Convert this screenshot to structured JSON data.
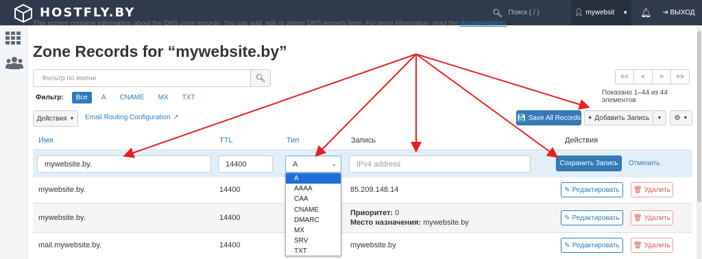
{
  "topbar": {
    "logo_text": "HOSTFLY.BY",
    "search_placeholder": "Поиск ( / )",
    "username": "mywebsit",
    "logout_label": "ВЫХОД"
  },
  "subline": {
    "text": "This screen contains information about the DNS zone records. You can add, edit or delete DNS records here. For more information, read the",
    "link": "documentation."
  },
  "page": {
    "title": "Zone Records for “mywebsite.by”"
  },
  "filter": {
    "placeholder": "Фильтр по имени",
    "label": "Фильтр:",
    "chips": [
      "Все",
      "A",
      "CNAME",
      "MX",
      "TXT"
    ]
  },
  "pagination": {
    "buttons": [
      "<<",
      "<",
      ">",
      ">>"
    ],
    "shown_text": "Показано 1–44 из 44 элементов"
  },
  "toolbar": {
    "actions_label": "Действия",
    "email_routing_label": "Email Routing Configuration",
    "save_all_label": "Save All Records",
    "add_record_label": "Добавить Запись"
  },
  "table": {
    "headers": {
      "name": "Имя",
      "ttl": "TTL",
      "type": "Тип",
      "record": "Запись",
      "actions": "Действия"
    },
    "new_record": {
      "name_value": "mywebsite.by.",
      "ttl_value": "14400",
      "type_value": "A",
      "record_placeholder": "IPv4 address",
      "save_label": "Сохранить Запись",
      "cancel_label": "Отменить"
    },
    "type_options": [
      "A",
      "AAAA",
      "CAA",
      "CNAME",
      "DMARC",
      "MX",
      "SRV",
      "TXT"
    ],
    "rows": [
      {
        "name": "mywebsite.by.",
        "ttl": "14400",
        "record": "85.209.148.14"
      },
      {
        "name": "mywebsite.by.",
        "ttl": "14400",
        "priority_label": "Приоритет:",
        "priority_value": "0",
        "dest_label": "Место назначения:",
        "dest_value": "mywebsite.by"
      },
      {
        "name": "mail.mywebsite.by.",
        "ttl": "14400",
        "record": "mywebsite.by"
      }
    ],
    "edit_label": "Редактировать",
    "delete_label": "Удалить"
  },
  "colors": {
    "topbar": "#2f3b4c",
    "accent": "#2d7bbf",
    "primary": "#337ab7",
    "danger": "#d9534f",
    "annotation_arrow": "#e8201f"
  }
}
